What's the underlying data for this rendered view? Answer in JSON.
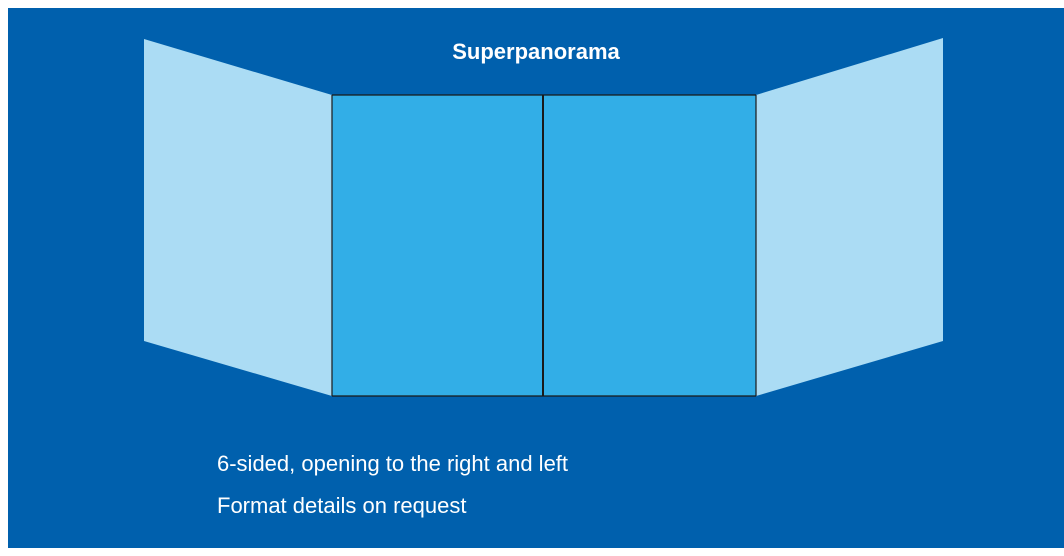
{
  "title": "Superpanorama",
  "captions": [
    "6-sided, opening to the right and left",
    "Format details on request"
  ],
  "colors": {
    "background": "#0060ad",
    "center_panels": "#32aee7",
    "side_panels": "#abdcf4",
    "divider": "#1a1a1a",
    "text": "#ffffff"
  },
  "panels": [
    {
      "name": "left-side-panel",
      "shade": "side_panels"
    },
    {
      "name": "center-left-panel",
      "shade": "center_panels"
    },
    {
      "name": "center-right-panel",
      "shade": "center_panels"
    },
    {
      "name": "right-side-panel",
      "shade": "side_panels"
    }
  ]
}
